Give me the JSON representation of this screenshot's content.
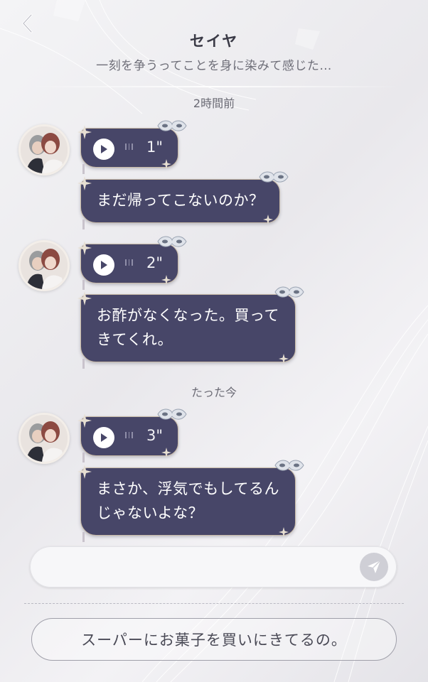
{
  "header": {
    "title": "セイヤ",
    "subtitle": "一刻を争うってことを身に染みて感じた…"
  },
  "messages": {
    "group1": {
      "timestamp": "2時間前",
      "voice": {
        "duration": "1\""
      },
      "text": "まだ帰ってこないのか？"
    },
    "group2": {
      "voice": {
        "duration": "2\""
      },
      "text_line1": "お酢がなくなった。買って",
      "text_line2": "きてくれ。"
    },
    "group3": {
      "timestamp": "たった今",
      "voice": {
        "duration": "3\""
      },
      "text_line1": "まさか、浮気でもしてるん",
      "text_line2": "じゃないよな？"
    }
  },
  "input": {
    "value": "",
    "placeholder": ""
  },
  "reply_option": {
    "label": "スーパーにお菓子を買いにきてるの。"
  },
  "colors": {
    "bubble": "#474668",
    "bubble_border": "#c7b9a6",
    "background": "#efeef2"
  },
  "icons": {
    "back": "chevron-left-icon",
    "play": "play-icon",
    "send": "paper-plane-icon",
    "decoration": "masquerade-mask-icon"
  }
}
